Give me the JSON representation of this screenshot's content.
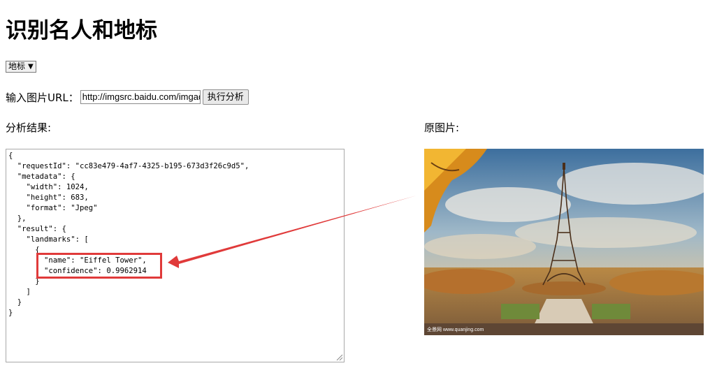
{
  "page": {
    "title": "识别名人和地标",
    "model_select": {
      "selected": "地标"
    },
    "url_label": "输入图片URL：",
    "url_value": "http://imgsrc.baidu.com/imgad/pic/item/",
    "run_button": "执行分析",
    "result_label": "分析结果:",
    "image_label": "原图片:"
  },
  "result_lines": [
    "{",
    "  \"requestId\": \"cc83e479-4af7-4325-b195-673d3f26c9d5\",",
    "  \"metadata\": {",
    "    \"width\": 1024,",
    "    \"height\": 683,",
    "    \"format\": \"Jpeg\"",
    "  },",
    "  \"result\": {",
    "    \"landmarks\": [",
    "      {",
    "        \"name\": \"Eiffel Tower\",",
    "        \"confidence\": 0.9962914",
    "      }",
    "    ]",
    "  }",
    "}"
  ],
  "image": {
    "watermark": "全景网 www.quanjing.com"
  },
  "colors": {
    "annotation_red": "#e03a3a"
  }
}
